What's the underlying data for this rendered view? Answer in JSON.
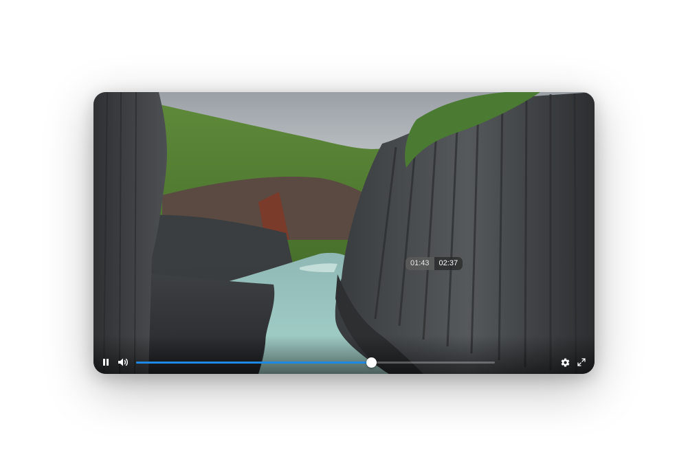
{
  "player": {
    "state": "playing",
    "current_time": "01:43",
    "duration": "02:37",
    "progress_fraction": 0.656,
    "accent_color": "#1e88e5",
    "controls": {
      "play_pause_icon": "pause-icon",
      "volume_icon": "volume-icon",
      "settings_icon": "gear-icon",
      "fullscreen_icon": "fullscreen-icon"
    }
  }
}
